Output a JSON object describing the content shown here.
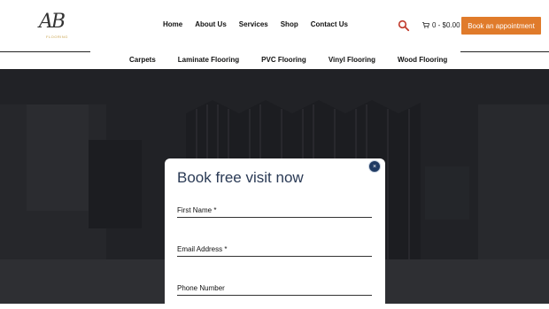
{
  "logo": {
    "text": "AB",
    "sub": "FLOORING"
  },
  "nav": {
    "items": [
      {
        "label": "Home"
      },
      {
        "label": "About Us"
      },
      {
        "label": "Services"
      },
      {
        "label": "Shop"
      },
      {
        "label": "Contact Us"
      }
    ]
  },
  "cart": {
    "label": "0 - $0.00"
  },
  "cta": {
    "label": "Book an appointment"
  },
  "subnav": {
    "items": [
      {
        "label": "Carpets"
      },
      {
        "label": "Laminate Flooring"
      },
      {
        "label": "PVC Flooring"
      },
      {
        "label": "Vinyl Flooring"
      },
      {
        "label": "Wood Flooring"
      }
    ]
  },
  "modal": {
    "title": "Book free visit now",
    "close": "×",
    "fields": {
      "first_name": "First Name *",
      "email": "Email Address *",
      "phone": "Phone Number"
    }
  },
  "colors": {
    "accent": "#e07b2b",
    "search": "#c0392b",
    "close_button": "#1f3a63",
    "title": "#2a3a55"
  }
}
